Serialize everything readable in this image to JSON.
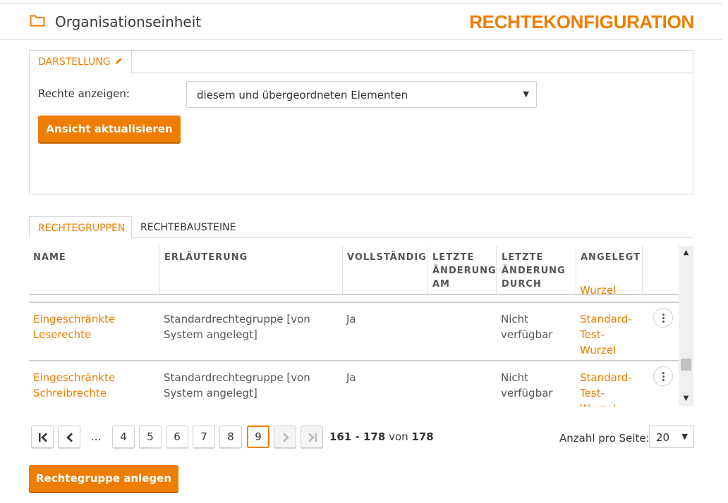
{
  "header": {
    "unit_title": "Organisationseinheit",
    "page_heading": "RECHTEKONFIGURATION"
  },
  "display_panel": {
    "tab_label": "DARSTELLUNG",
    "rights_label": "Rechte anzeigen:",
    "rights_select_value": "diesem und übergeordneten Elementen",
    "refresh_button": "Ansicht aktualisieren"
  },
  "tabs": {
    "groups": "RECHTEGRUPPEN",
    "blocks": "RECHTEBAUSTEINE"
  },
  "table": {
    "columns": {
      "name": "NAME",
      "explanation": "ERLÄUTERUNG",
      "complete": "VOLLSTÄNDIG",
      "changed_at": [
        "LETZTE",
        "ÄNDERUNG",
        "AM"
      ],
      "changed_by": [
        "LETZTE",
        "ÄNDERUNG",
        "DURCH"
      ],
      "created": "ANGELEGT"
    },
    "peek_text": "Wurzel",
    "rows": [
      {
        "name": [
          "Eingeschränkte",
          "Leserechte"
        ],
        "explanation": [
          "Standardrechtegruppe [von",
          "System angelegt]"
        ],
        "complete": "Ja",
        "changed_at": "",
        "changed_by": [
          "Nicht",
          "verfügbar"
        ],
        "created": [
          "Standard-",
          "Test-",
          "Wurzel"
        ]
      },
      {
        "name": [
          "Eingeschränkte",
          "Schreibrechte"
        ],
        "explanation": [
          "Standardrechtegruppe [von",
          "System angelegt]"
        ],
        "complete": "Ja",
        "changed_at": "",
        "changed_by": [
          "Nicht",
          "verfügbar"
        ],
        "created": [
          "Standard-",
          "Test-",
          "Wurzel"
        ]
      }
    ]
  },
  "pagination": {
    "ellipsis": "...",
    "pages": [
      "4",
      "5",
      "6",
      "7",
      "8",
      "9"
    ],
    "current_page": "9",
    "range": "161 - 178",
    "of_word": "von",
    "total": "178",
    "per_page_label": "Anzahl pro Seite:",
    "per_page_value": "20"
  },
  "create_button": "Rechtegruppe anlegen",
  "colors": {
    "accent": "#ef7d00",
    "border": "#d9d9d9"
  },
  "icons": [
    "folder-icon",
    "pencil-icon",
    "first-page-icon",
    "prev-page-icon",
    "next-page-icon",
    "last-page-icon",
    "more-vertical-icon",
    "dropdown-arrow-icon",
    "scroll-up-icon",
    "scroll-down-icon"
  ]
}
